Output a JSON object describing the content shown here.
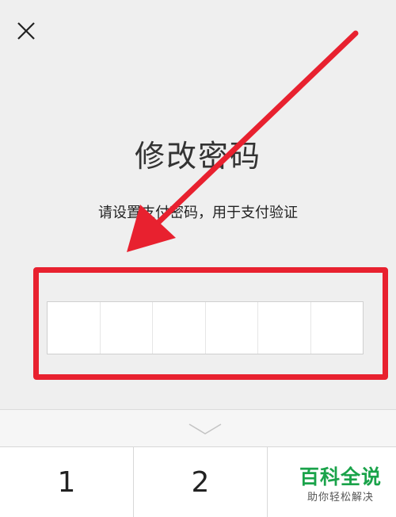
{
  "header": {
    "title": "修改密码",
    "subtitle": "请设置支付密码，用于支付验证"
  },
  "pin_input": {
    "digits": 6,
    "cells": [
      "",
      "",
      "",
      "",
      "",
      ""
    ]
  },
  "keyboard": {
    "keys": [
      "1",
      "2",
      ""
    ]
  },
  "watermark": {
    "main": "百科全说",
    "sub": "助你轻松解决"
  },
  "colors": {
    "background": "#efefef",
    "annotation_red": "#e8212f",
    "watermark_green": "#1aa34a"
  },
  "icons": {
    "close": "close-icon",
    "collapse": "chevron-down-icon"
  }
}
